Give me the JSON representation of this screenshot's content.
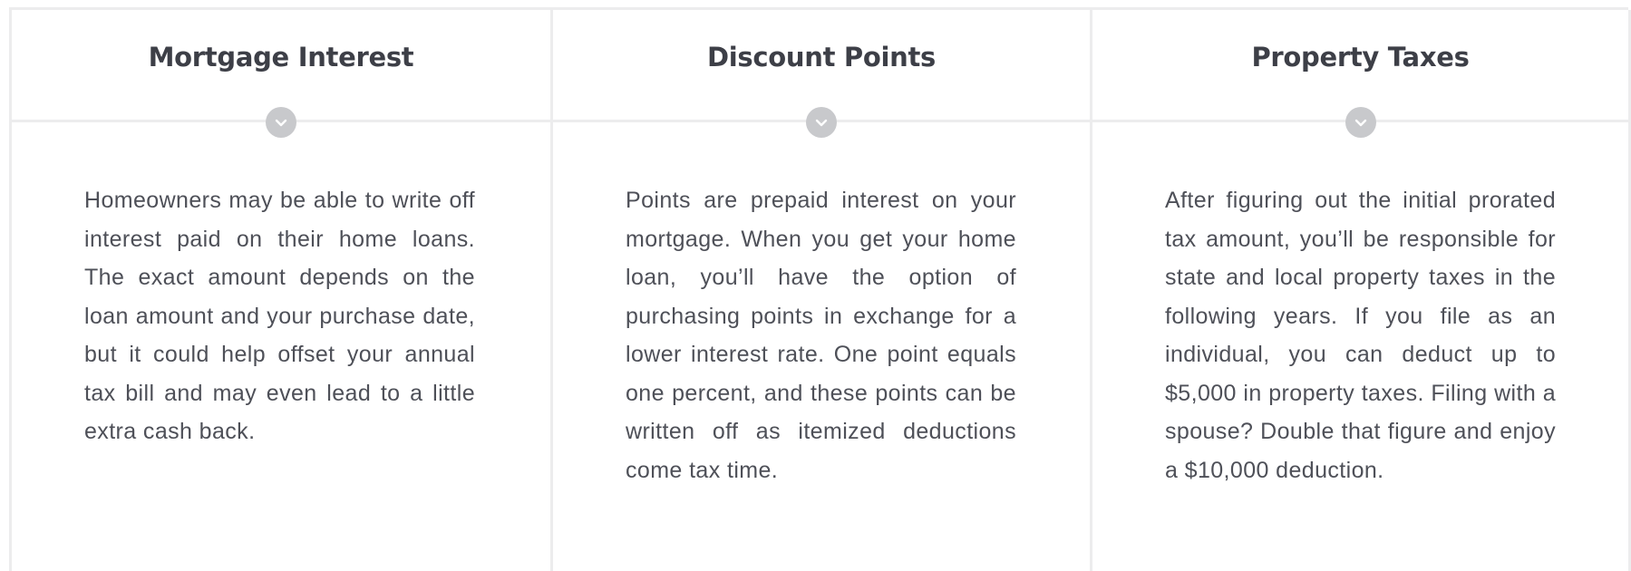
{
  "features": [
    {
      "title": "Mortgage Interest",
      "toggle_icon": "chevron-down-icon",
      "body": "Homeowners may be able to write off interest paid on their home loans. The exact amount depends on the loan amount and your purchase date, but it could help offset your annual tax bill and may even lead to a little extra cash back."
    },
    {
      "title": "Discount Points",
      "toggle_icon": "chevron-down-icon",
      "body": "Points are prepaid interest on your mortgage. When you get your home loan, you’ll have the option of purchasing points in exchange for a lower interest rate. One point equals one percent, and these points can be written off as itemized deductions come tax time."
    },
    {
      "title": "Property Taxes",
      "toggle_icon": "chevron-down-icon",
      "body": "After figuring out the initial prorated tax amount, you’ll be responsible for state and local property taxes in the following years. If you file as an individual, you can deduct up to $5,000 in property taxes. Filing with a spouse? Double that figure and enjoy a $10,000 deduction."
    }
  ],
  "colors": {
    "border": "#ececed",
    "title": "#3d3f47",
    "body_text": "#4e5058",
    "toggle_bg": "#c8c9cc",
    "toggle_glyph": "#ffffff"
  }
}
